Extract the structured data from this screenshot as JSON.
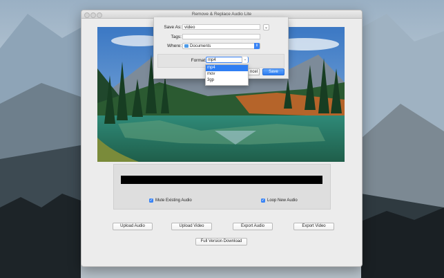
{
  "window": {
    "title": "Remove & Replace Audio Lite"
  },
  "save_dialog": {
    "save_as_label": "Save As:",
    "save_as_value": "video",
    "tags_label": "Tags:",
    "tags_value": "",
    "where_label": "Where:",
    "where_value": "Documents",
    "format_label": "Format:",
    "format_value": "mp4",
    "cancel_label": "ncel",
    "save_label": "Save"
  },
  "format_dropdown": {
    "options": [
      "mp4",
      "mov",
      "3gp"
    ],
    "selected": "mp4"
  },
  "options": {
    "mute_existing_audio": {
      "label": "Mute Existing Audio",
      "checked": true
    },
    "loop_new_audio": {
      "label": "Loop New Audio",
      "checked": true
    }
  },
  "buttons": {
    "upload_audio": "Upload Audio",
    "upload_video": "Upload Video",
    "export_audio": "Export Audio",
    "export_video": "Export Video",
    "full_version": "Full Version Download"
  },
  "colors": {
    "accent": "#3a84f5",
    "waveform": "#000000"
  },
  "icons": {
    "where_folder": "folder-icon",
    "expand": "chevron-down-icon",
    "checkbox": "checkmark-icon"
  }
}
